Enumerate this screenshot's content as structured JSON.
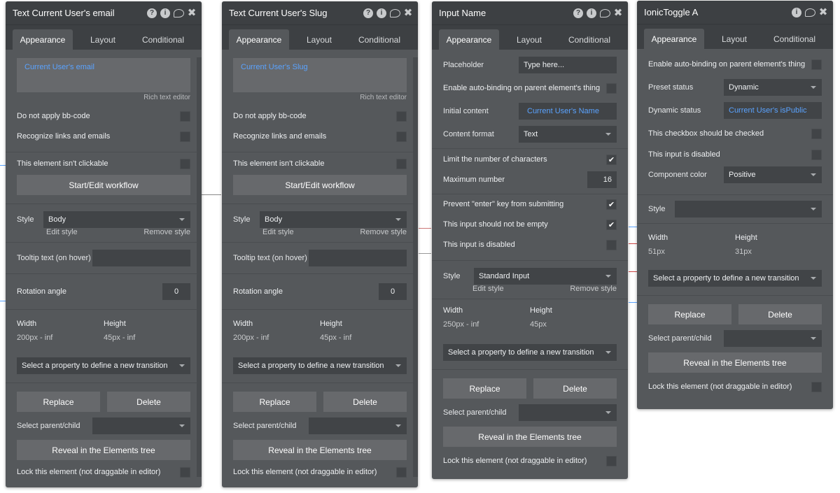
{
  "panels": [
    {
      "title": "Text Current User's email",
      "tabs": [
        "Appearance",
        "Layout",
        "Conditional"
      ],
      "rich_text_value": "Current User's email",
      "rich_text_note": "Rich text editor",
      "do_not_apply_bbcode": "Do not apply bb-code",
      "recognize_links": "Recognize links and emails",
      "not_clickable": "This element isn't clickable",
      "workflow_button": "Start/Edit workflow",
      "style_label": "Style",
      "style_value": "Body",
      "edit_style": "Edit style",
      "remove_style": "Remove style",
      "tooltip_label": "Tooltip text (on hover)",
      "rotation_label": "Rotation angle",
      "rotation_value": "0",
      "width_label": "Width",
      "width_value": "200px - inf",
      "height_label": "Height",
      "height_value": "45px - inf",
      "transition": "Select a property to define a new transition",
      "replace": "Replace",
      "delete": "Delete",
      "select_parent": "Select parent/child",
      "reveal": "Reveal in the Elements tree",
      "lock": "Lock this element (not draggable in editor)"
    },
    {
      "title": "Text Current User's Slug",
      "tabs": [
        "Appearance",
        "Layout",
        "Conditional"
      ],
      "rich_text_value": "Current User's Slug",
      "rich_text_note": "Rich text editor",
      "do_not_apply_bbcode": "Do not apply bb-code",
      "recognize_links": "Recognize links and emails",
      "not_clickable": "This element isn't clickable",
      "workflow_button": "Start/Edit workflow",
      "style_label": "Style",
      "style_value": "Body",
      "edit_style": "Edit style",
      "remove_style": "Remove style",
      "tooltip_label": "Tooltip text (on hover)",
      "rotation_label": "Rotation angle",
      "rotation_value": "0",
      "width_label": "Width",
      "width_value": "200px - inf",
      "height_label": "Height",
      "height_value": "45px - inf",
      "transition": "Select a property to define a new transition",
      "replace": "Replace",
      "delete": "Delete",
      "select_parent": "Select parent/child",
      "reveal": "Reveal in the Elements tree",
      "lock": "Lock this element (not draggable in editor)"
    },
    {
      "title": "Input Name",
      "tabs": [
        "Appearance",
        "Layout",
        "Conditional"
      ],
      "placeholder_label": "Placeholder",
      "placeholder_value": "Type here...",
      "auto_binding": "Enable auto-binding on parent element's thing",
      "initial_content_label": "Initial content",
      "initial_content_value": "Current User's Name",
      "content_format_label": "Content format",
      "content_format_value": "Text",
      "limit_chars": "Limit the number of characters",
      "max_number_label": "Maximum number",
      "max_number_value": "16",
      "prevent_enter": "Prevent \"enter\" key from submitting",
      "not_empty": "This input should not be empty",
      "disabled": "This input is disabled",
      "style_label": "Style",
      "style_value": "Standard Input",
      "edit_style": "Edit style",
      "remove_style": "Remove style",
      "width_label": "Width",
      "width_value": "250px - inf",
      "height_label": "Height",
      "height_value": "45px",
      "transition": "Select a property to define a new transition",
      "replace": "Replace",
      "delete": "Delete",
      "select_parent": "Select parent/child",
      "reveal": "Reveal in the Elements tree",
      "lock": "Lock this element (not draggable in editor)"
    },
    {
      "title": "IonicToggle A",
      "tabs": [
        "Appearance",
        "Layout",
        "Conditional"
      ],
      "auto_binding": "Enable auto-binding on parent element's thing",
      "preset_status_label": "Preset status",
      "preset_status_value": "Dynamic",
      "dynamic_status_label": "Dynamic status",
      "dynamic_status_value": "Current User's isPublic",
      "should_be_checked": "This checkbox should be checked",
      "disabled": "This input is disabled",
      "component_color_label": "Component color",
      "component_color_value": "Positive",
      "style_label": "Style",
      "width_label": "Width",
      "width_value": "51px",
      "height_label": "Height",
      "height_value": "31px",
      "transition": "Select a property to define a new transition",
      "replace": "Replace",
      "delete": "Delete",
      "select_parent": "Select parent/child",
      "reveal": "Reveal in the Elements tree",
      "lock": "Lock this element (not draggable in editor)"
    }
  ],
  "check_mark": "✔",
  "colors": {
    "panel_bg": "#55585b",
    "header_bg": "#3d4043",
    "dynamic_text": "#5aa3ff"
  }
}
